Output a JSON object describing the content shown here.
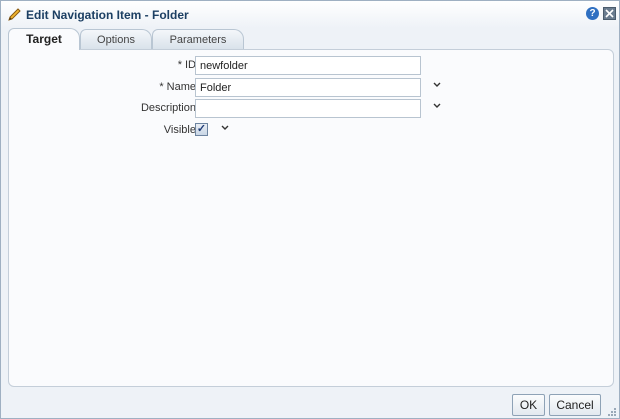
{
  "dialog": {
    "title": "Edit Navigation Item - Folder",
    "help_symbol": "?",
    "icons": {
      "title": "pencil-icon",
      "help": "help-icon",
      "close": "close-icon",
      "dropdown": "chevron-down-icon",
      "resize": "resize-grip-icon"
    }
  },
  "tabs": [
    {
      "label": "Target",
      "active": true
    },
    {
      "label": "Options",
      "active": false
    },
    {
      "label": "Parameters",
      "active": false
    }
  ],
  "form": {
    "required_marker": "*",
    "id": {
      "label": "ID",
      "value": "newfolder"
    },
    "name": {
      "label": "Name",
      "value": "Folder"
    },
    "description": {
      "label": "Description",
      "value": ""
    },
    "visible": {
      "label": "Visible",
      "checked": true,
      "check_symbol": "✓"
    }
  },
  "buttons": {
    "ok": "OK",
    "cancel": "Cancel"
  },
  "colors": {
    "title": "#1c3f63",
    "background": "#eef2f7",
    "panel": "#fafbfd"
  }
}
